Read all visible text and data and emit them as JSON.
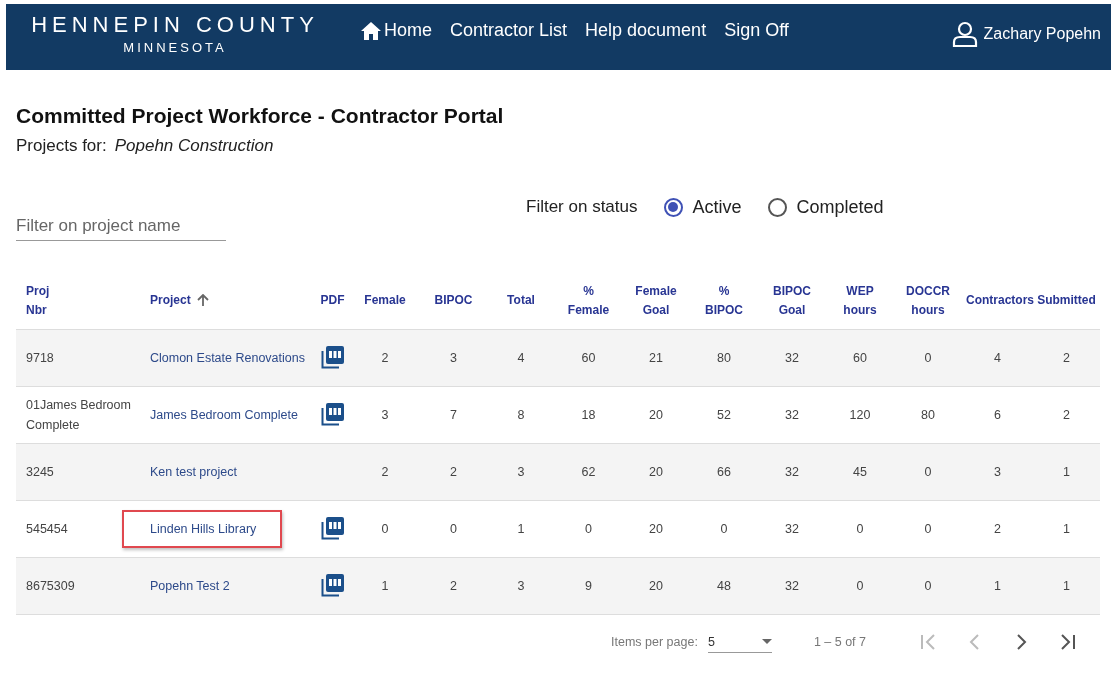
{
  "header": {
    "logo_title": "HENNEPIN COUNTY",
    "logo_subtitle": "MINNESOTA",
    "nav": [
      {
        "label": "Home",
        "kind": "home"
      },
      {
        "label": "Contractor List",
        "kind": "link"
      },
      {
        "label": "Help document",
        "kind": "link"
      },
      {
        "label": "Sign Off",
        "kind": "link"
      }
    ],
    "user": "Zachary Popehn"
  },
  "page": {
    "title": "Committed Project Workforce - Contractor Portal",
    "projects_for_label": "Projects for:",
    "company": "Popehn Construction"
  },
  "filter": {
    "placeholder": "Filter on project name",
    "status_label": "Filter on status",
    "statuses": [
      {
        "label": "Active",
        "selected": true
      },
      {
        "label": "Completed",
        "selected": false
      }
    ]
  },
  "table": {
    "columns": [
      {
        "label": "Proj Nbr",
        "kind": "text"
      },
      {
        "label": "Project",
        "kind": "link",
        "sorted": true
      },
      {
        "label": "PDF",
        "kind": "pdf"
      },
      {
        "label": "Female",
        "kind": "num"
      },
      {
        "label": "BIPOC",
        "kind": "num"
      },
      {
        "label": "Total",
        "kind": "num"
      },
      {
        "label": "% Female",
        "kind": "num"
      },
      {
        "label": "Female Goal",
        "kind": "num"
      },
      {
        "label": "% BIPOC",
        "kind": "num"
      },
      {
        "label": "BIPOC Goal",
        "kind": "num"
      },
      {
        "label": "WEP hours",
        "kind": "num"
      },
      {
        "label": "DOCCR hours",
        "kind": "num"
      },
      {
        "label": "Contractors",
        "kind": "num"
      },
      {
        "label": "Submitted",
        "kind": "num"
      }
    ],
    "rows": [
      {
        "highlighted": false,
        "cells": [
          "9718",
          "Clomon Estate Renovations",
          true,
          "2",
          "3",
          "4",
          "60",
          "21",
          "80",
          "32",
          "60",
          "0",
          "4",
          "2"
        ]
      },
      {
        "highlighted": false,
        "cells": [
          "01James Bedroom Complete",
          "James Bedroom Complete",
          true,
          "3",
          "7",
          "8",
          "18",
          "20",
          "52",
          "32",
          "120",
          "80",
          "6",
          "2"
        ]
      },
      {
        "highlighted": false,
        "cells": [
          "3245",
          "Ken test project",
          false,
          "2",
          "2",
          "3",
          "62",
          "20",
          "66",
          "32",
          "45",
          "0",
          "3",
          "1"
        ]
      },
      {
        "highlighted": true,
        "cells": [
          "545454",
          "Linden Hills Library",
          true,
          "0",
          "0",
          "1",
          "0",
          "20",
          "0",
          "32",
          "0",
          "0",
          "2",
          "1"
        ]
      },
      {
        "highlighted": false,
        "cells": [
          "8675309",
          "Popehn Test 2",
          true,
          "1",
          "2",
          "3",
          "9",
          "20",
          "48",
          "32",
          "0",
          "0",
          "1",
          "1"
        ]
      }
    ]
  },
  "paginator": {
    "items_label": "Items per page:",
    "page_size": "5",
    "range": "1 – 5 of 7",
    "buttons": [
      {
        "kind": "first",
        "disabled": true
      },
      {
        "kind": "prev",
        "disabled": true
      },
      {
        "kind": "next",
        "disabled": false
      },
      {
        "kind": "last",
        "disabled": false
      }
    ]
  }
}
